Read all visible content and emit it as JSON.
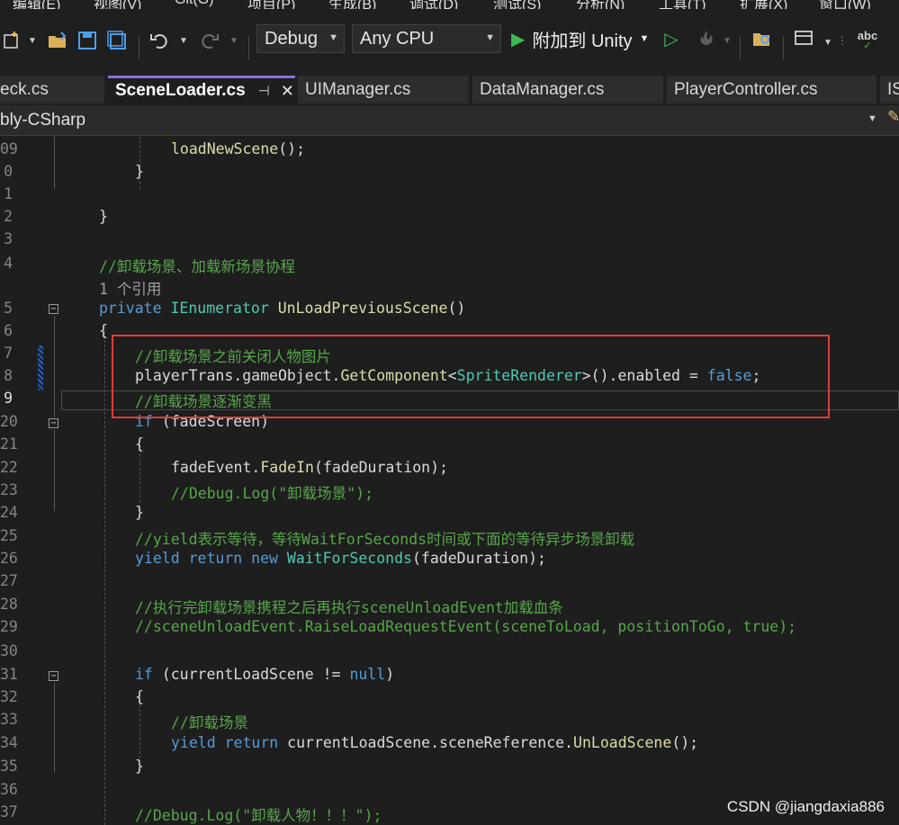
{
  "menu": [
    "编辑(E)",
    "视图(V)",
    "Git(G)",
    "项目(P)",
    "生成(B)",
    "调试(D)",
    "测试(S)",
    "分析(N)",
    "工具(T)",
    "扩展(X)",
    "窗口(W)"
  ],
  "toolbar": {
    "config": "Debug",
    "platform": "Any CPU",
    "attach_label": "附加到 Unity",
    "spell_label": "abc"
  },
  "tabs": [
    {
      "label": "eck.cs"
    },
    {
      "label": "SceneLoader.cs",
      "pin": "⊣",
      "close": "✕"
    },
    {
      "label": "UIManager.cs"
    },
    {
      "label": "DataManager.cs"
    },
    {
      "label": "PlayerController.cs"
    },
    {
      "label": "IS"
    }
  ],
  "navbar": {
    "project": "bly-CSharp"
  },
  "lines": [
    {
      "n": "09",
      "parts": [
        {
          "t": "loadNewScene",
          "c": "fn"
        },
        {
          "t": "();",
          "c": ""
        }
      ]
    },
    {
      "n": "0",
      "parts": [
        {
          "t": "}",
          "c": ""
        }
      ]
    },
    {
      "n": "1",
      "parts": []
    },
    {
      "n": "2",
      "parts": [
        {
          "t": "}",
          "c": ""
        }
      ]
    },
    {
      "n": "3",
      "parts": []
    },
    {
      "n": "4",
      "parts": [
        {
          "t": "//卸载场景、加载新场景协程",
          "c": "cm"
        }
      ]
    },
    {
      "n": "",
      "parts": [
        {
          "t": "1 个引用",
          "c": "ref"
        }
      ]
    },
    {
      "n": "5",
      "parts": [
        {
          "t": "private ",
          "c": "kw"
        },
        {
          "t": "IEnumerator ",
          "c": "ty"
        },
        {
          "t": "UnLoadPreviousScene",
          "c": "fn"
        },
        {
          "t": "()",
          "c": ""
        }
      ]
    },
    {
      "n": "6",
      "parts": [
        {
          "t": "{",
          "c": ""
        }
      ]
    },
    {
      "n": "7",
      "parts": [
        {
          "t": "//卸载场景之前关闭人物图片",
          "c": "cm"
        }
      ]
    },
    {
      "n": "8",
      "parts": [
        {
          "t": "playerTrans.gameObject.",
          "c": ""
        },
        {
          "t": "GetComponent",
          "c": "fn"
        },
        {
          "t": "<",
          "c": ""
        },
        {
          "t": "SpriteRenderer",
          "c": "ty"
        },
        {
          "t": ">().enabled = ",
          "c": ""
        },
        {
          "t": "false",
          "c": "kw"
        },
        {
          "t": ";",
          "c": ""
        }
      ]
    },
    {
      "n": "9",
      "parts": [
        {
          "t": "//卸载场景逐渐变黑",
          "c": "cm"
        }
      ]
    },
    {
      "n": "20",
      "parts": [
        {
          "t": "if ",
          "c": "kw"
        },
        {
          "t": "(fadeScreen)",
          "c": ""
        }
      ]
    },
    {
      "n": "21",
      "parts": [
        {
          "t": "{",
          "c": ""
        }
      ]
    },
    {
      "n": "22",
      "parts": [
        {
          "t": "fadeEvent.",
          "c": ""
        },
        {
          "t": "FadeIn",
          "c": "fn"
        },
        {
          "t": "(fadeDuration);",
          "c": ""
        }
      ]
    },
    {
      "n": "23",
      "parts": [
        {
          "t": "//Debug.Log(\"卸载场景\");",
          "c": "cm"
        }
      ]
    },
    {
      "n": "24",
      "parts": [
        {
          "t": "}",
          "c": ""
        }
      ]
    },
    {
      "n": "25",
      "parts": [
        {
          "t": "//yield表示等待，等待WaitForSeconds时间或下面的等待异步场景卸载",
          "c": "cm"
        }
      ]
    },
    {
      "n": "26",
      "parts": [
        {
          "t": "yield return new ",
          "c": "kw"
        },
        {
          "t": "WaitForSeconds",
          "c": "ty"
        },
        {
          "t": "(fadeDuration);",
          "c": ""
        }
      ]
    },
    {
      "n": "27",
      "parts": []
    },
    {
      "n": "28",
      "parts": [
        {
          "t": "//执行完卸载场景携程之后再执行sceneUnloadEvent加载血条",
          "c": "cm"
        }
      ]
    },
    {
      "n": "29",
      "parts": [
        {
          "t": "//sceneUnloadEvent.RaiseLoadRequestEvent(sceneToLoad, positionToGo, true);",
          "c": "cm"
        }
      ]
    },
    {
      "n": "30",
      "parts": []
    },
    {
      "n": "31",
      "parts": [
        {
          "t": "if ",
          "c": "kw"
        },
        {
          "t": "(currentLoadScene != ",
          "c": ""
        },
        {
          "t": "null",
          "c": "kw"
        },
        {
          "t": ")",
          "c": ""
        }
      ]
    },
    {
      "n": "32",
      "parts": [
        {
          "t": "{",
          "c": ""
        }
      ]
    },
    {
      "n": "33",
      "parts": [
        {
          "t": "//卸载场景",
          "c": "cm"
        }
      ]
    },
    {
      "n": "34",
      "parts": [
        {
          "t": "yield return ",
          "c": "kw"
        },
        {
          "t": "currentLoadScene.sceneReference.",
          "c": ""
        },
        {
          "t": "UnLoadScene",
          "c": "fn"
        },
        {
          "t": "();",
          "c": ""
        }
      ]
    },
    {
      "n": "35",
      "parts": [
        {
          "t": "}",
          "c": ""
        }
      ]
    },
    {
      "n": "36",
      "parts": []
    },
    {
      "n": "37",
      "parts": [
        {
          "t": "//Debug.Log(\"卸载人物！！！\");",
          "c": "cm"
        }
      ]
    }
  ],
  "watermark": "CSDN @jiangdaxia886"
}
